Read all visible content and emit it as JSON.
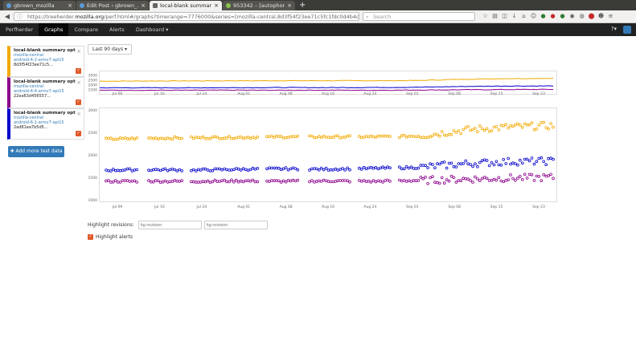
{
  "tabs": [
    {
      "label": "gbrown_mozilla",
      "active": false,
      "icon": "globe-icon"
    },
    {
      "label": "Edit Post ‹ gbrown_...",
      "active": false,
      "icon": "globe-icon"
    },
    {
      "label": "local-blank summar...",
      "active": true,
      "icon": "treeherder-icon"
    },
    {
      "label": "953342 – [autophon...",
      "active": false,
      "icon": "bugzilla-icon"
    }
  ],
  "url": {
    "prefix": "https://treeherder.",
    "domain": "mozilla.org",
    "suffix": "/perf.html#/graphs?timerange=7776000&series=[mozilla-central,8d3f54f23ee71c5fc1fdc0d4b4c83d6b"
  },
  "search_placeholder": "Search",
  "nav": {
    "brand": "Perfherder",
    "items": [
      "Graphs",
      "Compare",
      "Alerts",
      "Dashboard ▾"
    ],
    "help": "?▾"
  },
  "series": [
    {
      "name": "local-blank summary opt",
      "repo": "mozilla-central",
      "platform": "android-4-2-armv7-api15",
      "hash": "8d3f54f23ee71c5...",
      "color": "#f2a900"
    },
    {
      "name": "local-blank summary opt",
      "repo": "mozilla-central",
      "platform": "android-4-4-armv7-api15",
      "hash": "22ea63d456557...",
      "color": "#8b008b"
    },
    {
      "name": "local-blank summary opt",
      "repo": "mozilla-central",
      "platform": "android-6-1-armv7-api15",
      "hash": "2ad81ea7b5d5...",
      "color": "#0000cc"
    }
  ],
  "add_button": "Add more test data",
  "timerange": "Last 90 days ▾",
  "x_labels": [
    "Jul 09",
    "Jul 16",
    "Jul 24",
    "Aug 01",
    "Aug 08",
    "Aug 16",
    "Aug 24",
    "Sep 01",
    "Sep 08",
    "Sep 15",
    "Sep 23"
  ],
  "overview_y_labels": [
    "3000",
    "2500",
    "2000",
    "1500"
  ],
  "main_y_labels": [
    "3000",
    "2500",
    "2000",
    "1500",
    "1000"
  ],
  "highlight": {
    "label": "Highlight revisions:",
    "placeholder1": "hg revision",
    "placeholder2": "hg revision"
  },
  "highlight_alerts": "Highlight alerts",
  "chart_data": {
    "type": "scatter",
    "x": [
      "Jul 09",
      "Jul 16",
      "Jul 24",
      "Aug 01",
      "Aug 08",
      "Aug 16",
      "Aug 24",
      "Sep 01",
      "Sep 08",
      "Sep 15",
      "Sep 23"
    ],
    "ylim": [
      1000,
      3000
    ],
    "series": [
      {
        "name": "android-4-2-armv7-api15",
        "color": "#f2a900",
        "values": [
          2350,
          2370,
          2380,
          2390,
          2400,
          2400,
          2400,
          2420,
          2550,
          2620,
          2650
        ]
      },
      {
        "name": "android-4-4-armv7-api15",
        "color": "#8b008b",
        "values": [
          1410,
          1415,
          1410,
          1420,
          1410,
          1420,
          1410,
          1430,
          1460,
          1480,
          1500
        ]
      },
      {
        "name": "android-6-1-armv7-api15",
        "color": "#0000cc",
        "values": [
          1660,
          1670,
          1660,
          1680,
          1690,
          1680,
          1700,
          1720,
          1800,
          1850,
          1860
        ]
      }
    ]
  }
}
